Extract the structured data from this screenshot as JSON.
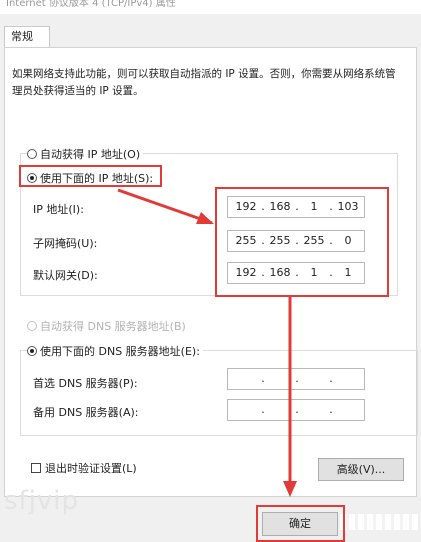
{
  "window": {
    "title": "Internet 协议版本 4 (TCP/IPv4) 属性"
  },
  "tab": {
    "label": "常规"
  },
  "description": "如果网络支持此功能，则可以获取自动指派的 IP 设置。否则，你需要从网络系统管理员处获得适当的 IP 设置。",
  "ip_mode": {
    "auto_label": "自动获得 IP 地址(O)",
    "manual_label": "使用下面的 IP 地址(S):",
    "selected": "manual"
  },
  "ip_fields": [
    {
      "label": "IP 地址(I):",
      "octets": [
        "192",
        "168",
        "1",
        "103"
      ]
    },
    {
      "label": "子网掩码(U):",
      "octets": [
        "255",
        "255",
        "255",
        "0"
      ]
    },
    {
      "label": "默认网关(D):",
      "octets": [
        "192",
        "168",
        "1",
        "1"
      ]
    }
  ],
  "dns_mode": {
    "auto_label": "自动获得 DNS 服务器地址(B)",
    "manual_label": "使用下面的 DNS 服务器地址(E):",
    "selected": "manual"
  },
  "dns_fields": [
    {
      "label": "首选 DNS 服务器(P):",
      "octets": [
        "",
        "",
        "",
        ""
      ]
    },
    {
      "label": "备用 DNS 服务器(A):",
      "octets": [
        "",
        "",
        "",
        ""
      ]
    }
  ],
  "validate_on_exit": {
    "label": "退出时验证设置(L)",
    "checked": false
  },
  "advanced_button": "高级(V)...",
  "ok_button": "确定",
  "watermark": "sfjvip",
  "colors": {
    "annotation": "#e23a36"
  }
}
